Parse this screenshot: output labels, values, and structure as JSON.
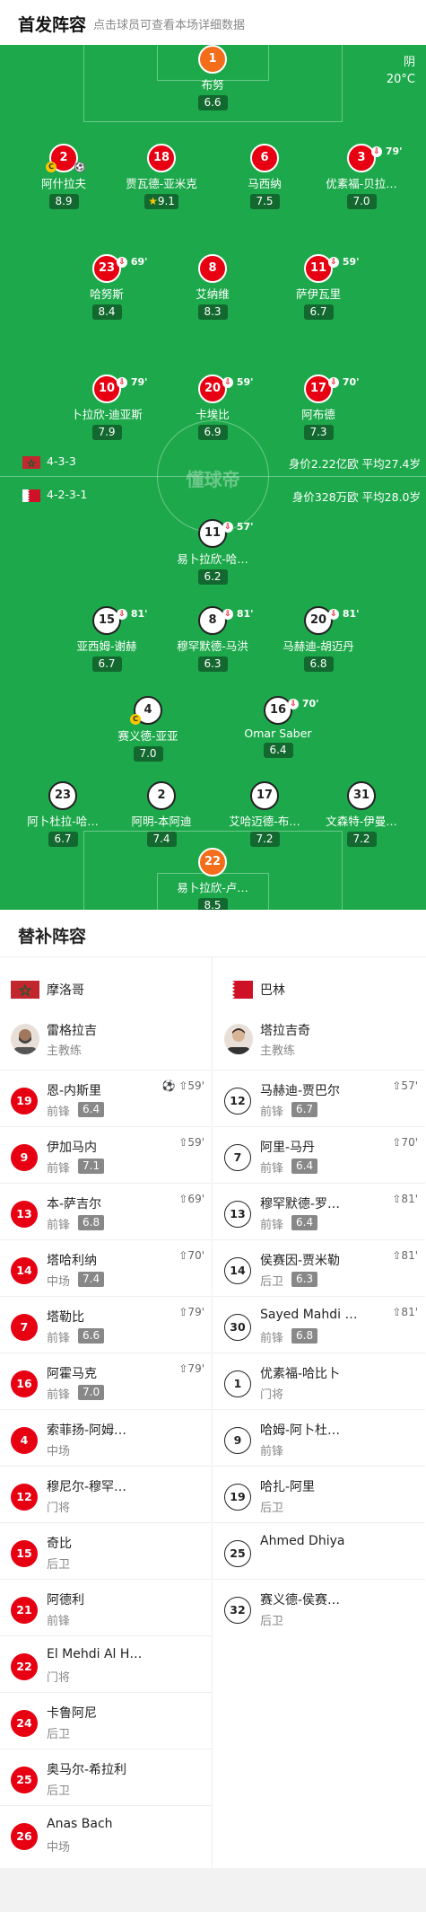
{
  "header": {
    "title": "首发阵容",
    "subtitle": "点击球员可查看本场详细数据"
  },
  "weather": {
    "condition": "阴",
    "temp": "20°C"
  },
  "watermark": "懂球帝",
  "home": {
    "flag_icon": "morocco-flag-icon",
    "formation": "4-3-3",
    "value": "身价2.22亿欧 平均27.4岁",
    "players": [
      {
        "num": "1",
        "name": "布努",
        "rating": "6.6"
      },
      {
        "num": "2",
        "name": "阿什拉夫",
        "rating": "8.9"
      },
      {
        "num": "18",
        "name": "贾瓦德-亚米克",
        "rating": "9.1"
      },
      {
        "num": "6",
        "name": "马西纳",
        "rating": "7.5"
      },
      {
        "num": "3",
        "name": "优素福-贝拉…",
        "rating": "7.0",
        "sub": "79'"
      },
      {
        "num": "23",
        "name": "哈努斯",
        "rating": "8.4",
        "sub": "69'"
      },
      {
        "num": "8",
        "name": "艾纳维",
        "rating": "8.3"
      },
      {
        "num": "11",
        "name": "萨伊瓦里",
        "rating": "6.7",
        "sub": "59'"
      },
      {
        "num": "10",
        "name": "卜拉欣-迪亚斯",
        "rating": "7.9",
        "sub": "79'"
      },
      {
        "num": "20",
        "name": "卡埃比",
        "rating": "6.9",
        "sub": "59'"
      },
      {
        "num": "17",
        "name": "阿布德",
        "rating": "7.3",
        "sub": "70'"
      }
    ]
  },
  "away": {
    "flag_icon": "bahrain-flag-icon",
    "formation": "4-2-3-1",
    "value": "身价328万欧 平均28.0岁",
    "players": [
      {
        "num": "11",
        "name": "易卜拉欣-哈…",
        "rating": "6.2",
        "sub": "57'"
      },
      {
        "num": "15",
        "name": "亚西姆-谢赫",
        "rating": "6.7",
        "sub": "81'"
      },
      {
        "num": "8",
        "name": "穆罕默德-马洪",
        "rating": "6.3",
        "sub": "81'"
      },
      {
        "num": "20",
        "name": "马赫迪-胡迈丹",
        "rating": "6.8",
        "sub": "81'"
      },
      {
        "num": "4",
        "name": "赛义德-亚亚",
        "rating": "7.0"
      },
      {
        "num": "16",
        "name": "Omar Saber",
        "rating": "6.4",
        "sub": "70'"
      },
      {
        "num": "23",
        "name": "阿卜杜拉-哈…",
        "rating": "6.7"
      },
      {
        "num": "2",
        "name": "阿明-本阿迪",
        "rating": "7.4"
      },
      {
        "num": "17",
        "name": "艾哈迈德-布…",
        "rating": "7.2"
      },
      {
        "num": "31",
        "name": "文森特-伊曼…",
        "rating": "7.2"
      },
      {
        "num": "22",
        "name": "易卜拉欣-卢…",
        "rating": "8.5"
      }
    ]
  },
  "bench": {
    "title": "替补阵容",
    "home": {
      "team": "摩洛哥",
      "coach": {
        "name": "雷格拉吉",
        "role": "主教练"
      },
      "players": [
        {
          "num": "19",
          "name": "恩-内斯里",
          "pos": "前锋",
          "rating": "6.4",
          "event": "⚽ ⇧59'"
        },
        {
          "num": "9",
          "name": "伊加马内",
          "pos": "前锋",
          "rating": "7.1",
          "event": "⇧59'"
        },
        {
          "num": "13",
          "name": "本-萨吉尔",
          "pos": "前锋",
          "rating": "6.8",
          "event": "⇧69'"
        },
        {
          "num": "14",
          "name": "塔哈利纳",
          "pos": "中场",
          "rating": "7.4",
          "event": "⇧70'"
        },
        {
          "num": "7",
          "name": "塔勒比",
          "pos": "前锋",
          "rating": "6.6",
          "event": "⇧79'"
        },
        {
          "num": "16",
          "name": "阿霍马克",
          "pos": "前锋",
          "rating": "7.0",
          "event": "⇧79'"
        },
        {
          "num": "4",
          "name": "索菲扬-阿姆…",
          "pos": "中场"
        },
        {
          "num": "12",
          "name": "穆尼尔-穆罕…",
          "pos": "门将"
        },
        {
          "num": "15",
          "name": "奇比",
          "pos": "后卫"
        },
        {
          "num": "21",
          "name": "阿德利",
          "pos": "前锋"
        },
        {
          "num": "22",
          "name": "El Mehdi Al H…",
          "pos": "门将"
        },
        {
          "num": "24",
          "name": "卡鲁阿尼",
          "pos": "后卫"
        },
        {
          "num": "25",
          "name": "奥马尔-希拉利",
          "pos": "后卫"
        },
        {
          "num": "26",
          "name": "Anas Bach",
          "pos": "中场"
        }
      ]
    },
    "away": {
      "team": "巴林",
      "coach": {
        "name": "塔拉吉奇",
        "role": "主教练"
      },
      "players": [
        {
          "num": "12",
          "name": "马赫迪-贾巴尔",
          "pos": "前锋",
          "rating": "6.7",
          "event": "⇧57'"
        },
        {
          "num": "7",
          "name": "阿里-马丹",
          "pos": "前锋",
          "rating": "6.4",
          "event": "⇧70'"
        },
        {
          "num": "13",
          "name": "穆罕默德-罗…",
          "pos": "前锋",
          "rating": "6.4",
          "event": "⇧81'"
        },
        {
          "num": "14",
          "name": "侯赛因-贾米勒",
          "pos": "后卫",
          "rating": "6.3",
          "event": "⇧81'"
        },
        {
          "num": "30",
          "name": "Sayed Mahdi …",
          "pos": "前锋",
          "rating": "6.8",
          "event": "⇧81'"
        },
        {
          "num": "1",
          "name": "优素福-哈比卜",
          "pos": "门将"
        },
        {
          "num": "9",
          "name": "哈姆-阿卜杜…",
          "pos": "前锋"
        },
        {
          "num": "19",
          "name": "哈扎-阿里",
          "pos": "后卫"
        },
        {
          "num": "25",
          "name": "Ahmed Dhiya",
          "pos": ""
        },
        {
          "num": "32",
          "name": "赛义德-侯赛…",
          "pos": "后卫"
        }
      ]
    }
  },
  "colors": {
    "pitch": "#1da94b",
    "home": "#e60012",
    "gk": "#f36d1a"
  }
}
